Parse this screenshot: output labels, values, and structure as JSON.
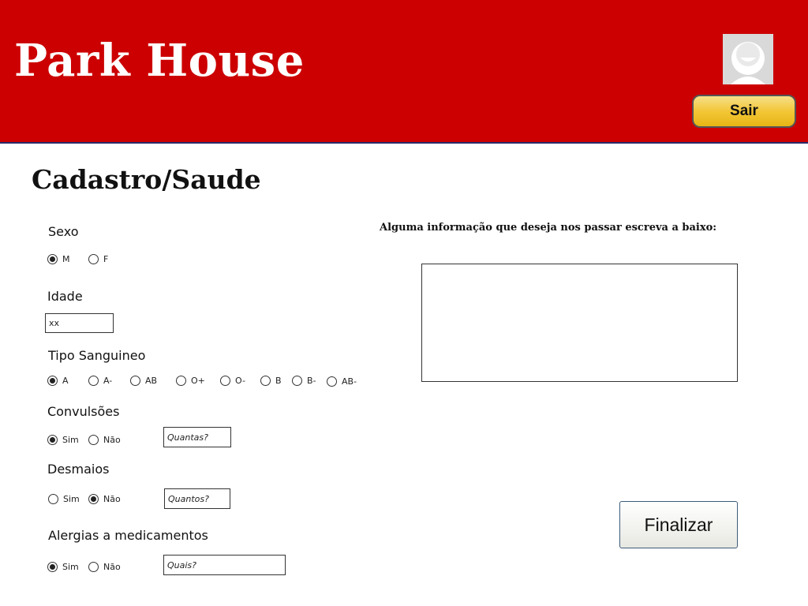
{
  "header": {
    "brand": "Park House",
    "logout_label": "Sair"
  },
  "page": {
    "title": "Cadastro/Saude"
  },
  "form": {
    "sexo": {
      "label": "Sexo",
      "options": [
        "M",
        "F"
      ],
      "selected": "M"
    },
    "idade": {
      "label": "Idade",
      "value": "xx"
    },
    "tipo_sanguineo": {
      "label": "Tipo Sanguineo",
      "options": [
        "A",
        "A-",
        "AB",
        "O+",
        "O-",
        "B",
        "B-",
        "AB-"
      ],
      "selected": "A"
    },
    "convulsoes": {
      "label": "Convulsões",
      "yes": "Sim",
      "no": "Não",
      "selected": "Sim",
      "count_placeholder": "Quantas?"
    },
    "desmaios": {
      "label": "Desmaios",
      "yes": "Sim",
      "no": "Não",
      "selected": "Não",
      "count_placeholder": "Quantos?"
    },
    "alergias": {
      "label": "Alergias a medicamentos",
      "yes": "Sim",
      "no": "Não",
      "selected": "Sim",
      "which_placeholder": "Quais?"
    }
  },
  "notes": {
    "label": "Alguma informação que deseja nos passar escreva a baixo:",
    "value": ""
  },
  "actions": {
    "finish_label": "Finalizar"
  }
}
